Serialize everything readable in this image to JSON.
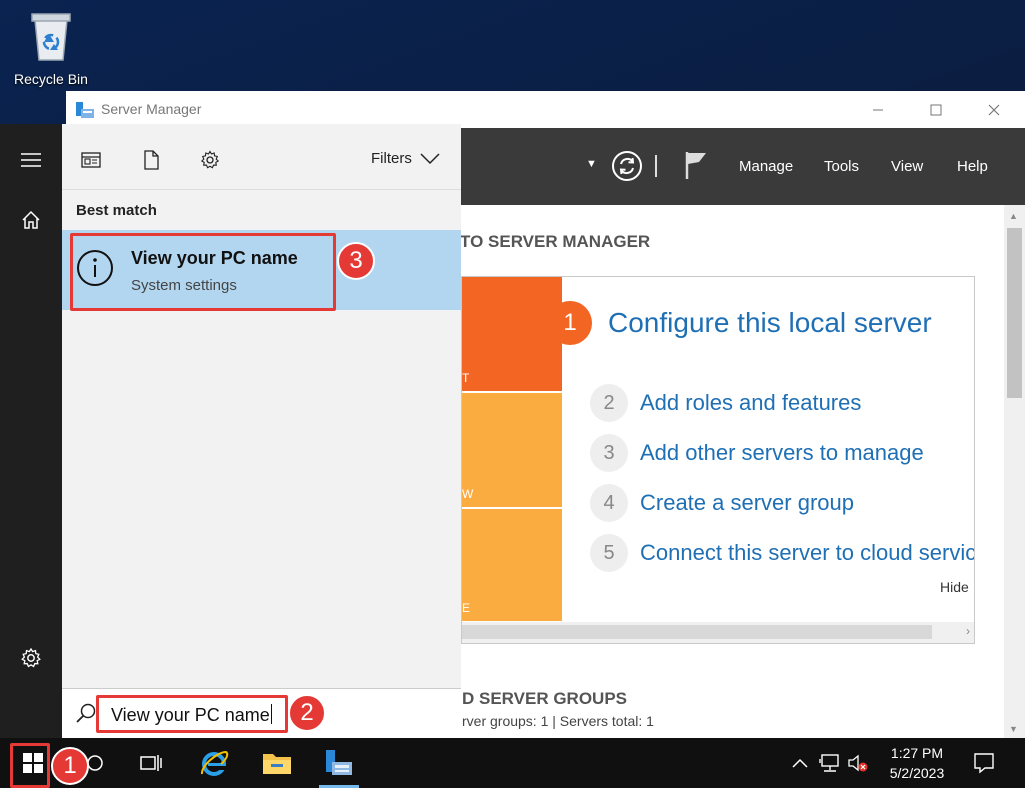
{
  "desktop": {
    "recycle_bin_label": "Recycle Bin"
  },
  "server_manager": {
    "title": "Server Manager",
    "menu": [
      "Manage",
      "Tools",
      "View",
      "Help"
    ],
    "welcome_title": "TO SERVER MANAGER",
    "quick_start": {
      "tile_letters": [
        "T",
        "W",
        "E"
      ],
      "tile_colors": [
        "#f26522",
        "#fbac40",
        "#fbac40"
      ],
      "main_step": {
        "num": "1",
        "label": "Configure this local server"
      },
      "steps": [
        {
          "num": "2",
          "label": "Add roles and features"
        },
        {
          "num": "3",
          "label": "Add other servers to manage"
        },
        {
          "num": "4",
          "label": "Create a server group"
        },
        {
          "num": "5",
          "label": "Connect this server to cloud servic"
        }
      ],
      "hide_label": "Hide"
    },
    "roles_title": "D SERVER GROUPS",
    "roles_subtitle": "rver groups: 1   |   Servers total: 1"
  },
  "start_menu": {
    "filters_label": "Filters",
    "best_match_label": "Best match",
    "result": {
      "title": "View your PC name",
      "subtitle": "System settings"
    },
    "search_value": "View your PC name"
  },
  "annotations": {
    "badge_start": "1",
    "badge_search": "2",
    "badge_result": "3",
    "color": "#e53935"
  },
  "taskbar": {
    "time": "1:27 PM",
    "date": "5/2/2023"
  }
}
